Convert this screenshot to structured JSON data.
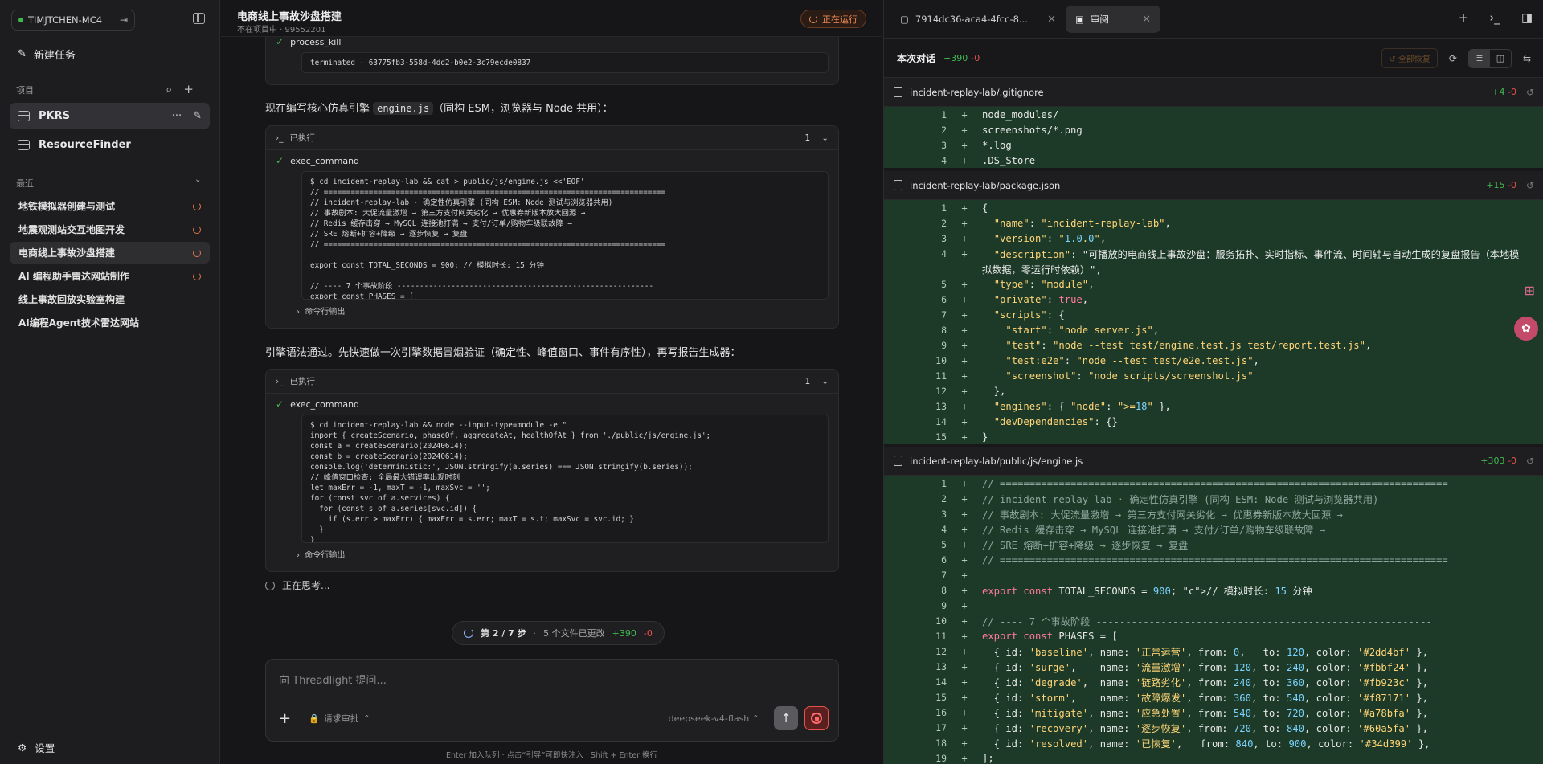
{
  "sidebar": {
    "account": "TIMJTCHEN-MC4",
    "new_task": "新建任务",
    "projects_label": "项目",
    "projects": [
      {
        "name": "PKRS",
        "active": true
      },
      {
        "name": "ResourceFinder",
        "active": false
      }
    ],
    "recent_label": "最近",
    "recent": [
      {
        "name": "地铁模拟器创建与测试",
        "running": true,
        "active": false
      },
      {
        "name": "地震观测站交互地图开发",
        "running": true,
        "active": false
      },
      {
        "name": "电商线上事故沙盘搭建",
        "running": true,
        "active": true
      },
      {
        "name": "AI 编程助手雷达网站制作",
        "running": true,
        "active": false
      },
      {
        "name": "线上事故回放实验室构建",
        "running": false,
        "active": false
      },
      {
        "name": "AI编程Agent技术雷达网站",
        "running": false,
        "active": false
      }
    ],
    "settings": "设置"
  },
  "chat": {
    "title": "电商线上事故沙盘搭建",
    "subtitle": "不在项目中 · 99552201",
    "status": "正在运行",
    "prev_tool": {
      "name": "process_kill",
      "output": "terminated · 63775fb3-558d-4dd2-b0e2-3c79ecde0837"
    },
    "para1_pre": "现在编写核心仿真引擎 ",
    "para1_code": "engine.js",
    "para1_post": "（同构 ESM，浏览器与 Node 共用）：",
    "card1": {
      "header": "已执行",
      "count": "1",
      "tool": "exec_command",
      "code": "$ cd incident-replay-lab && cat > public/js/engine.js <<'EOF'\n// ============================================================================\n// incident-replay-lab · 确定性仿真引擎 (同构 ESM: Node 测试与浏览器共用)\n// 事故剧本: 大促流量激增 → 第三方支付网关劣化 → 优惠券新版本放大回源 →\n// Redis 缓存击穿 → MySQL 连接池打满 → 支付/订单/购物车级联故障 →\n// SRE 熔断+扩容+降级 → 逐步恢复 → 复盘\n// ============================================================================\n\nexport const TOTAL_SECONDS = 900; // 模拟时长: 15 分钟\n\n// ---- 7 个事故阶段 ---------------------------------------------------------\nexport const PHASES = [",
      "output_label": "命令行输出"
    },
    "para2": "引擎语法通过。先快速做一次引擎数据冒烟验证（确定性、峰值窗口、事件有序性），再写报告生成器：",
    "card2": {
      "header": "已执行",
      "count": "1",
      "tool": "exec_command",
      "code": "$ cd incident-replay-lab && node --input-type=module -e \"\nimport { createScenario, phaseOf, aggregateAt, healthOfAt } from './public/js/engine.js';\nconst a = createScenario(20240614);\nconst b = createScenario(20240614);\nconsole.log('deterministic:', JSON.stringify(a.series) === JSON.stringify(b.series));\n// 峰值窗口检查: 全局最大错误率出现时刻\nlet maxErr = -1, maxT = -1, maxSvc = '';\nfor (const svc of a.services) {\n  for (const s of a.series[svc.id]) {\n    if (s.err > maxErr) { maxErr = s.err; maxT = s.t; maxSvc = svc.id; }\n  }\n}",
      "output_label": "命令行输出"
    },
    "thinking": "正在思考...",
    "steps": {
      "label": "第 2 / 7 步",
      "files": "5 个文件已更改",
      "plus": "+390",
      "minus": "-0"
    },
    "composer": {
      "placeholder": "向 Threadlight 提问...",
      "approval": "请求审批",
      "model": "deepseek-v4-flash"
    },
    "hint": "Enter 加入队列 · 点击“引导”可即快注入 · Shift + Enter 换行"
  },
  "review": {
    "tabs": [
      {
        "label": "7914dc36-aca4-4fcc-8...",
        "active": false
      },
      {
        "label": "审阅",
        "active": true
      }
    ],
    "header": {
      "label": "本次对话",
      "plus": "+390",
      "minus": "-0",
      "restore": "全部恢复"
    },
    "files": [
      {
        "path": "incident-replay-lab/.gitignore",
        "plus": "+4",
        "minus": "-0",
        "lines": [
          "node_modules/",
          "screenshots/*.png",
          "*.log",
          ".DS_Store"
        ]
      },
      {
        "path": "incident-replay-lab/package.json",
        "plus": "+15",
        "minus": "-0",
        "lines": [
          "{",
          "  \"name\": \"incident-replay-lab\",",
          "  \"version\": \"1.0.0\",",
          "  \"description\": \"可播放的电商线上事故沙盘：服务拓扑、实时指标、事件流、时间轴与自动生成的复盘报告（本地模",
          "拟数据，零运行时依赖）\",",
          "  \"type\": \"module\",",
          "  \"private\": true,",
          "  \"scripts\": {",
          "    \"start\": \"node server.js\",",
          "    \"test\": \"node --test test/engine.test.js test/report.test.js\",",
          "    \"test:e2e\": \"node --test test/e2e.test.js\",",
          "    \"screenshot\": \"node scripts/screenshot.js\"",
          "  },",
          "  \"engines\": { \"node\": \">=18\" },",
          "  \"devDependencies\": {}",
          "}"
        ],
        "numbers": [
          "1",
          "2",
          "3",
          "4",
          "",
          "5",
          "6",
          "7",
          "8",
          "9",
          "10",
          "11",
          "12",
          "13",
          "14",
          "15"
        ]
      },
      {
        "path": "incident-replay-lab/public/js/engine.js",
        "plus": "+303",
        "minus": "-0",
        "lines": [
          "// ============================================================================",
          "// incident-replay-lab · 确定性仿真引擎 (同构 ESM: Node 测试与浏览器共用)",
          "// 事故剧本: 大促流量激增 → 第三方支付网关劣化 → 优惠券新版本放大回源 →",
          "// Redis 缓存击穿 → MySQL 连接池打满 → 支付/订单/购物车级联故障 →",
          "// SRE 熔断+扩容+降级 → 逐步恢复 → 复盘",
          "// ============================================================================",
          "",
          "export const TOTAL_SECONDS = 900; // 模拟时长: 15 分钟",
          "",
          "// ---- 7 个事故阶段 ---------------------------------------------------------",
          "export const PHASES = [",
          "  { id: 'baseline', name: '正常运营', from: 0,   to: 120, color: '#2dd4bf' },",
          "  { id: 'surge',    name: '流量激增', from: 120, to: 240, color: '#fbbf24' },",
          "  { id: 'degrade',  name: '链路劣化', from: 240, to: 360, color: '#fb923c' },",
          "  { id: 'storm',    name: '故障爆发', from: 360, to: 540, color: '#f87171' },",
          "  { id: 'mitigate', name: '应急处置', from: 540, to: 720, color: '#a78bfa' },",
          "  { id: 'recovery', name: '逐步恢复', from: 720, to: 840, color: '#60a5fa' },",
          "  { id: 'resolved', name: '已恢复',   from: 840, to: 900, color: '#34d399' },",
          "];"
        ]
      }
    ]
  }
}
